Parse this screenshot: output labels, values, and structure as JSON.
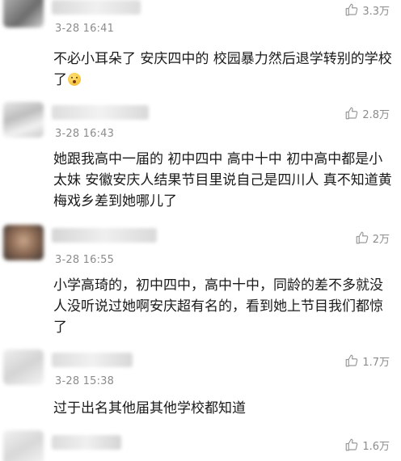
{
  "comments": [
    {
      "time": "3-28 16:41",
      "likes": "3.3万",
      "text": "不必小耳朵了 安庆四中的 校园暴力然后退学转别的学校了",
      "emoji": "shocked-face-emoji"
    },
    {
      "time": "3-28 16:43",
      "likes": "2.8万",
      "text": "她跟我高中一届的 初中四中 高中十中 初中高中都是小太妹 安徽安庆人结果节目里说自己是四川人 真不知道黄梅戏乡差到她哪儿了"
    },
    {
      "time": "3-28 16:55",
      "likes": "2万",
      "text": "小学高琦的，初中四中，高中十中，同龄的差不多就没人没听说过她啊安庆超有名的，看到她上节目我们都惊了"
    },
    {
      "time": "3-28 15:38",
      "likes": "1.7万",
      "text": "过于出名其他届其他学校都知道"
    },
    {
      "time": "",
      "likes": "1.6万",
      "text": ""
    }
  ],
  "colors": {
    "meta_text": "#8c8c8c",
    "body_text": "#1a1a1a"
  }
}
